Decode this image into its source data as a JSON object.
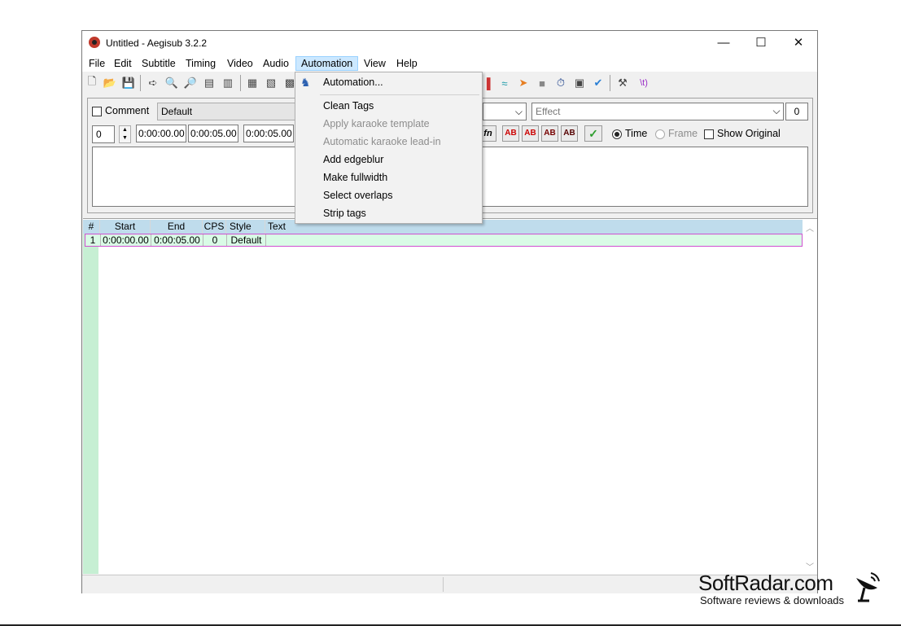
{
  "window": {
    "title": "Untitled - Aegisub 3.2.2",
    "controls": {
      "minimize": "—",
      "maximize": "☐",
      "close": "✕"
    }
  },
  "menubar": [
    "File",
    "Edit",
    "Subtitle",
    "Timing",
    "Video",
    "Audio",
    "Automation",
    "View",
    "Help"
  ],
  "automation_menu": {
    "items": [
      {
        "label": "Automation...",
        "disabled": false,
        "has_icon": true
      },
      {
        "label": "Clean Tags",
        "disabled": false
      },
      {
        "label": "Apply karaoke template",
        "disabled": true
      },
      {
        "label": "Automatic karaoke lead-in",
        "disabled": true
      },
      {
        "label": "Add edgeblur",
        "disabled": false
      },
      {
        "label": "Make fullwidth",
        "disabled": false
      },
      {
        "label": "Select overlaps",
        "disabled": false
      },
      {
        "label": "Strip tags",
        "disabled": false
      }
    ]
  },
  "toolbar": {
    "icons": [
      "new-file-icon",
      "open-folder-icon",
      "save-icon",
      "jump-icon",
      "zoom-in-icon",
      "zoom-out-icon",
      "video-icon",
      "video-zoom-icon",
      "subtitle-icon",
      "subtitle-alt-icon",
      "film-icon",
      "automation-icon",
      "audio-icon",
      "wave-icon",
      "fish-icon",
      "stop-icon",
      "clock-icon",
      "tag-icon",
      "spellcheck-icon",
      "tools-icon",
      "code-icon"
    ],
    "code_label": "\\t)"
  },
  "edit": {
    "comment_label": "Comment",
    "style": "Default",
    "effect_placeholder": "Effect",
    "margin_value": "0",
    "layer": "0",
    "start": "0:00:00.00",
    "end": "0:00:05.00",
    "duration": "0:00:05.00",
    "fn_label": "fn",
    "ab_buttons": [
      "AB",
      "AB",
      "AB",
      "AB"
    ],
    "check_label": "✓",
    "time_label": "Time",
    "frame_label": "Frame",
    "show_original_label": "Show Original"
  },
  "grid": {
    "headers": [
      "#",
      "Start",
      "End",
      "CPS",
      "Style",
      "Text"
    ],
    "rows": [
      {
        "num": "1",
        "start": "0:00:00.00",
        "end": "0:00:05.00",
        "cps": "0",
        "style": "Default",
        "text": ""
      }
    ]
  },
  "watermark": {
    "title": "SoftRadar.com",
    "subtitle": "Software reviews & downloads"
  },
  "colors": {
    "menu_highlight": "#cce8ff",
    "grid_header": "#bfdcec",
    "row_selected": "#d9fbe6",
    "row_border": "#d050d0",
    "accent_red": "#c00000"
  }
}
